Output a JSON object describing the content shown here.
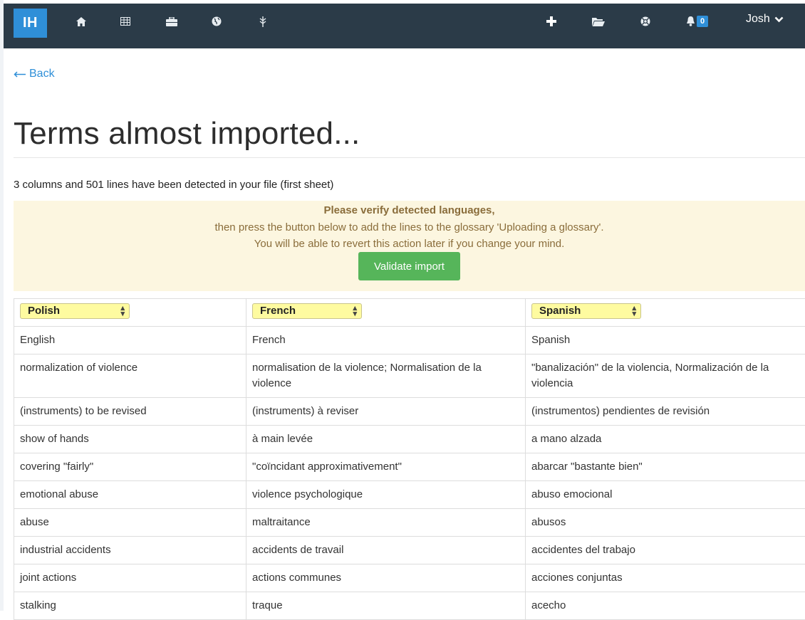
{
  "navbar": {
    "brand": "IH",
    "left_icons": [
      "home-icon",
      "table-icon",
      "briefcase-icon",
      "globe-icon",
      "leaf-icon"
    ],
    "right_icons": [
      "plus-icon",
      "folder-open-icon",
      "lifebuoy-icon",
      "bell-icon"
    ],
    "notification_count": "0",
    "user_name": "Josh"
  },
  "back_label": "Back",
  "page_title": "Terms almost imported...",
  "detection_text": "3 columns and 501 lines have been detected in your file (first sheet)",
  "alert": {
    "line1": "Please verify detected languages,",
    "line2": "then press the button below to add the lines to the glossary 'Uploading a glossary'.",
    "line3": "You will be able to revert this action later if you change your mind.",
    "button": "Validate import"
  },
  "colors": {
    "navbar": "#2b3b48",
    "brand": "#2f8fd8",
    "alert_bg": "#fcf6e0",
    "alert_text": "#8a6d3b",
    "button": "#56b55a",
    "select_bg": "#fefba0"
  },
  "table": {
    "language_selects": [
      "Polish",
      "French",
      "Spanish"
    ],
    "rows": [
      [
        "English",
        "French",
        "Spanish"
      ],
      [
        "normalization of violence",
        "normalisation de la violence; Normalisation de la violence",
        "\"banalización\" de la violencia, Normalización de la violencia"
      ],
      [
        "(instruments) to be revised",
        "(instruments) à reviser",
        "(instrumentos) pendientes de revisión"
      ],
      [
        "show of hands",
        "à main levée",
        "a mano alzada"
      ],
      [
        "covering \"fairly\"",
        "\"coïncidant approximativement\"",
        "abarcar \"bastante bien\""
      ],
      [
        "emotional abuse",
        "violence psychologique",
        "abuso emocional"
      ],
      [
        "abuse",
        "maltraitance",
        "abusos"
      ],
      [
        "industrial accidents",
        "accidents de travail",
        "accidentes del trabajo"
      ],
      [
        "joint actions",
        "actions communes",
        "acciones conjuntas"
      ],
      [
        "stalking",
        "traque",
        "acecho"
      ]
    ]
  }
}
